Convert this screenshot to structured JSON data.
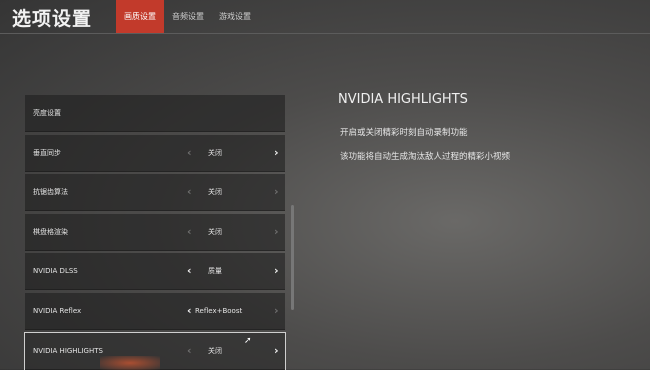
{
  "header": {
    "title": "选项设置",
    "tabs": [
      "画质设置",
      "音频设置",
      "游戏设置"
    ]
  },
  "settings": [
    {
      "label": "亮度设置",
      "value": ""
    },
    {
      "label": "垂直同步",
      "value": "关闭"
    },
    {
      "label": "抗锯齿算法",
      "value": "关闭"
    },
    {
      "label": "棋盘格渲染",
      "value": "关闭"
    },
    {
      "label": "NVIDIA DLSS",
      "value": "质量"
    },
    {
      "label": "NVIDIA Reflex",
      "value": "Reflex+Boost"
    },
    {
      "label": "NVIDIA HIGHLIGHTS",
      "value": "关闭"
    }
  ],
  "detail": {
    "title": "NVIDIA HIGHLIGHTS",
    "lines": [
      "开启或关闭精彩时刻自动录制功能",
      "该功能将自动生成淘汰敌人过程的精彩小视频"
    ]
  },
  "icons": {
    "left_arrow": "‹",
    "right_arrow": "›"
  },
  "colors": {
    "accent": "#c23a2b"
  }
}
